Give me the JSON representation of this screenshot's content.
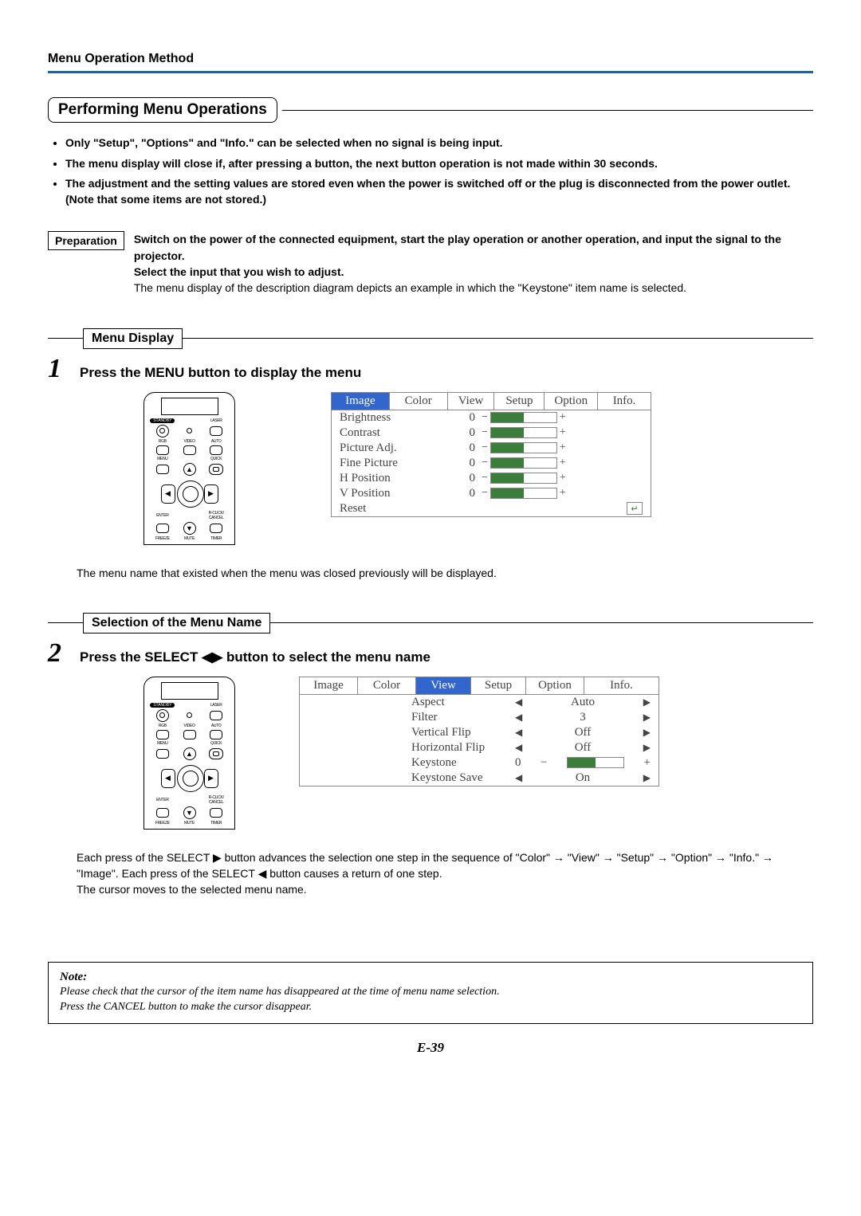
{
  "header": "Menu Operation Method",
  "section_title": "Performing Menu Operations",
  "bullets": [
    "Only \"Setup\", \"Options\" and \"Info.\" can be selected when no signal is being input.",
    "The menu display will close if, after pressing a button, the next button operation is not made within 30 seconds.",
    "The adjustment and the setting values are stored even when the power is switched off or the plug is disconnected from the power outlet."
  ],
  "bullets_note": "(Note that some items are not stored.)",
  "prep": {
    "label": "Preparation",
    "line1": "Switch on the power of the connected equipment, start the play operation or another operation, and input the signal to the projector.",
    "line2": "Select the input that you wish to adjust.",
    "line3": "The menu display of the description diagram depicts an example in which the \"Keystone\" item name is selected."
  },
  "sub1": {
    "label": "Menu Display",
    "step_num": "1",
    "step_text": "Press the MENU button to display the menu",
    "after_text": "The menu name that existed when the menu was closed previously will be displayed."
  },
  "remote": {
    "standby": "STANDBY",
    "laser": "LASER",
    "rgb": "RGB",
    "video": "VIDEO",
    "auto": "AUTO",
    "menu": "MENU",
    "quick": "QUICK",
    "enter": "ENTER",
    "rclick": "R-CLICK/\nCANCEL",
    "freeze": "FREEZE",
    "mute": "MUTE",
    "timer": "TIMER"
  },
  "menu1": {
    "tabs": [
      "Image",
      "Color",
      "View",
      "Setup",
      "Option",
      "Info."
    ],
    "active": 0,
    "rows": [
      {
        "name": "Brightness",
        "val": "0"
      },
      {
        "name": "Contrast",
        "val": "0"
      },
      {
        "name": "Picture Adj.",
        "val": "0"
      },
      {
        "name": "Fine Picture",
        "val": "0"
      },
      {
        "name": "H Position",
        "val": "0"
      },
      {
        "name": "V Position",
        "val": "0"
      }
    ],
    "reset": "Reset"
  },
  "sub2": {
    "label": "Selection of the Menu Name",
    "step_num": "2",
    "step_text_a": "Press the SELECT ",
    "step_text_b": " button to select the menu name",
    "after1": "Each press of the SELECT ▶ button advances the selection one step in the sequence of \"Color\" → \"View\" → \"Setup\" → \"Option\"  → \"Info.\" → \"Image\". Each press of the SELECT ◀ button causes a return of one step.",
    "after2": "The cursor moves to the selected menu name."
  },
  "menu2": {
    "tabs": [
      "Image",
      "Color",
      "View",
      "Setup",
      "Option",
      "Info."
    ],
    "active": 2,
    "rows": [
      {
        "name": "Aspect",
        "val": "Auto",
        "type": "sel"
      },
      {
        "name": "Filter",
        "val": "3",
        "type": "sel"
      },
      {
        "name": "Vertical Flip",
        "val": "Off",
        "type": "sel"
      },
      {
        "name": "Horizontal Flip",
        "val": "Off",
        "type": "sel"
      },
      {
        "name": "Keystone",
        "val": "0",
        "type": "slider"
      },
      {
        "name": "Keystone Save",
        "val": "On",
        "type": "sel"
      }
    ]
  },
  "note": {
    "title": "Note:",
    "line1": "Please check that the cursor of the item name has disappeared at the time of menu name selection.",
    "line2": "Press the CANCEL button to make the cursor disappear."
  },
  "page_num": "E-39"
}
